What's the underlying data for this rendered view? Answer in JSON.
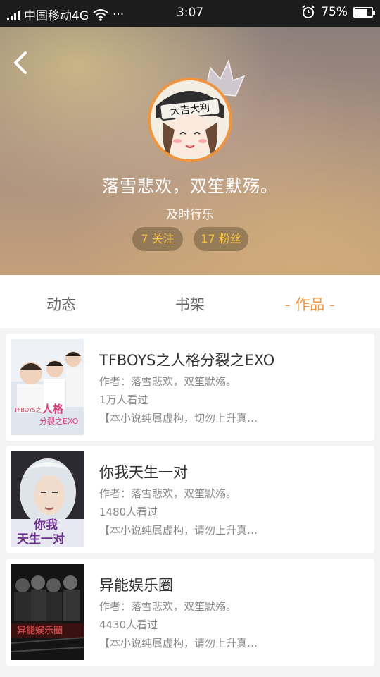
{
  "status_bar": {
    "carrier": "中国移动4G",
    "more": "···",
    "time": "3:07",
    "battery": "75%",
    "battery_level": 0.75
  },
  "profile": {
    "nickname": "落雪悲欢，双笙默殇。",
    "signature": "及时行乐",
    "following": "7 关注",
    "followers": "17 粉丝",
    "avatar_headband_text": "大吉大利",
    "accent": "#f0943e",
    "pill_text_color": "#f5c445"
  },
  "tabs": [
    {
      "label": "动态"
    },
    {
      "label": "书架"
    },
    {
      "label": "- 作品 -"
    }
  ],
  "works": [
    {
      "title": "TFBOYS之人格分裂之EXO",
      "author": "作者：落雪悲欢，双笙默殇。",
      "views": "1万人看过",
      "desc": "【本小说纯属虚构，切勿上升真…",
      "cover_text": "TFBOYS之人格分裂之EXO"
    },
    {
      "title": "你我天生一对",
      "author": "作者：落雪悲欢，双笙默殇。",
      "views": "1480人看过",
      "desc": "【本小说纯属虚构，请勿上升真…",
      "cover_text": "你我天生一对"
    },
    {
      "title": "异能娱乐圈",
      "author": "作者：落雪悲欢，双笙默殇。",
      "views": "4430人看过",
      "desc": "【本小说纯属虚构，请勿上升真…",
      "cover_text": "异能娱乐圈"
    }
  ]
}
